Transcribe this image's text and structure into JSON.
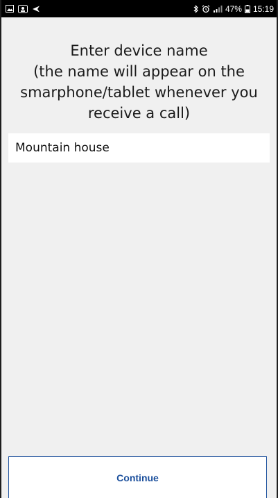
{
  "status_bar": {
    "left_icons": [
      "gallery-icon",
      "notification-icon",
      "send-icon"
    ],
    "right_icons": [
      "bluetooth-icon",
      "alarm-icon",
      "signal-icon",
      "battery-icon"
    ],
    "battery": "47%",
    "time": "15:19"
  },
  "header": {
    "lines": [
      "Enter device name",
      "(the name will appear on the",
      "smarphone/tablet whenever you",
      "receive a call)"
    ]
  },
  "device_name": {
    "value": "Mountain house"
  },
  "footer": {
    "continue_label": "Continue"
  },
  "colors": {
    "background": "#f0f0f0",
    "accent": "#1b4f9c",
    "status_bar": "#000000"
  }
}
